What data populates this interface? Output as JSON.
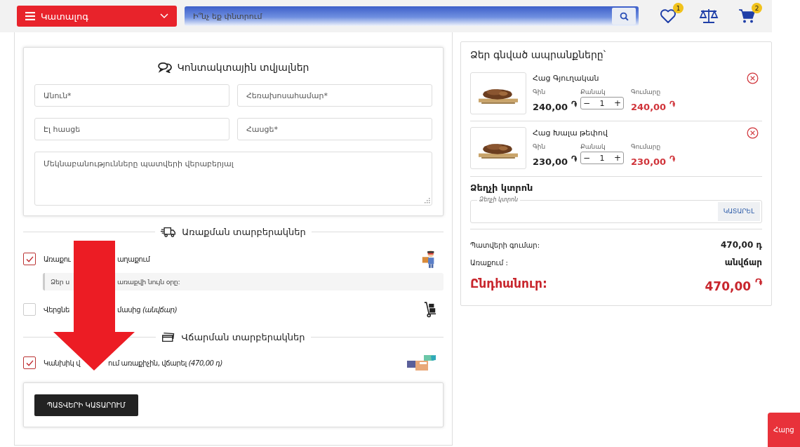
{
  "header": {
    "catalog_label": "Կատալոգ",
    "search": {
      "placeholder": "Ի՞նչ եք փնտրում"
    },
    "wishlist_count": "1",
    "cart_count": "2"
  },
  "contact": {
    "title": "Կոնտակտային տվյալներ",
    "fields": [
      {
        "placeholder": "Անուն*"
      },
      {
        "placeholder": "Հեռախոսահամար*"
      },
      {
        "placeholder": "Էլ հասցե"
      },
      {
        "placeholder": "Հասցե*"
      }
    ],
    "comment": {
      "placeholder": "Մեկնաբանությունները պատվերի վերաբերյալ"
    }
  },
  "delivery": {
    "title": "Առաքման տարբերակներ",
    "options": [
      {
        "parts": [
          "Առաքու",
          "աղաքում"
        ],
        "checked": true,
        "note_parts": [
          "Ձեր ս",
          "առաքվի նույն օրը:"
        ]
      },
      {
        "parts": [
          "Վերցնե",
          "մասից *(անվճար)*"
        ],
        "checked": false
      }
    ]
  },
  "payment": {
    "title": "Վճարման տարբերակներ",
    "options": [
      {
        "parts": [
          "Կանխիկ վ",
          "ում առաքիչին, վճարել *(470,00 դ)*"
        ],
        "checked": true
      }
    ]
  },
  "submit": "ՊԱՏՎԵՐԻ ԿԱՏԱՐՈՒՄ",
  "cart": {
    "title": "Ձեր գնված ապրանքները՝",
    "items": [
      {
        "kind": "picture",
        "name": "Հաց Գյուղական",
        "price_label": "Գին",
        "qty_label": "Քանակ",
        "sum_label": "Գումարը",
        "price": "240,00 $^{֏}$",
        "minus": "−",
        "quantity": "1",
        "plus": "+",
        "sum": "240,00 $^{֏}$"
      },
      {
        "kind": "picture",
        "name": "Հաց Խալա թեփով",
        "price_label": "Գին",
        "qty_label": "Քանակ",
        "sum_label": "Գումարը",
        "price": "230,00 $^{֏}$",
        "minus": "−",
        "quantity": "1",
        "plus": "+",
        "sum": "230,00 $^{֏}$"
      }
    ]
  },
  "coupon": {
    "title": "Ձեղչի կտրոն",
    "legend": "Ձեղչի կտրոն",
    "button": "ԿԱՏԱՐԵԼ"
  },
  "summary": {
    "rows": [
      {
        "label": "Պատվերի գումար:",
        "value": "470,00 դ"
      },
      {
        "label": "Առաքում :",
        "value": "անվճար"
      }
    ],
    "total": {
      "label": "Ընդհանուր:",
      "value": "470,00 $^{֏}$"
    }
  },
  "help_tab": "Հարց"
}
